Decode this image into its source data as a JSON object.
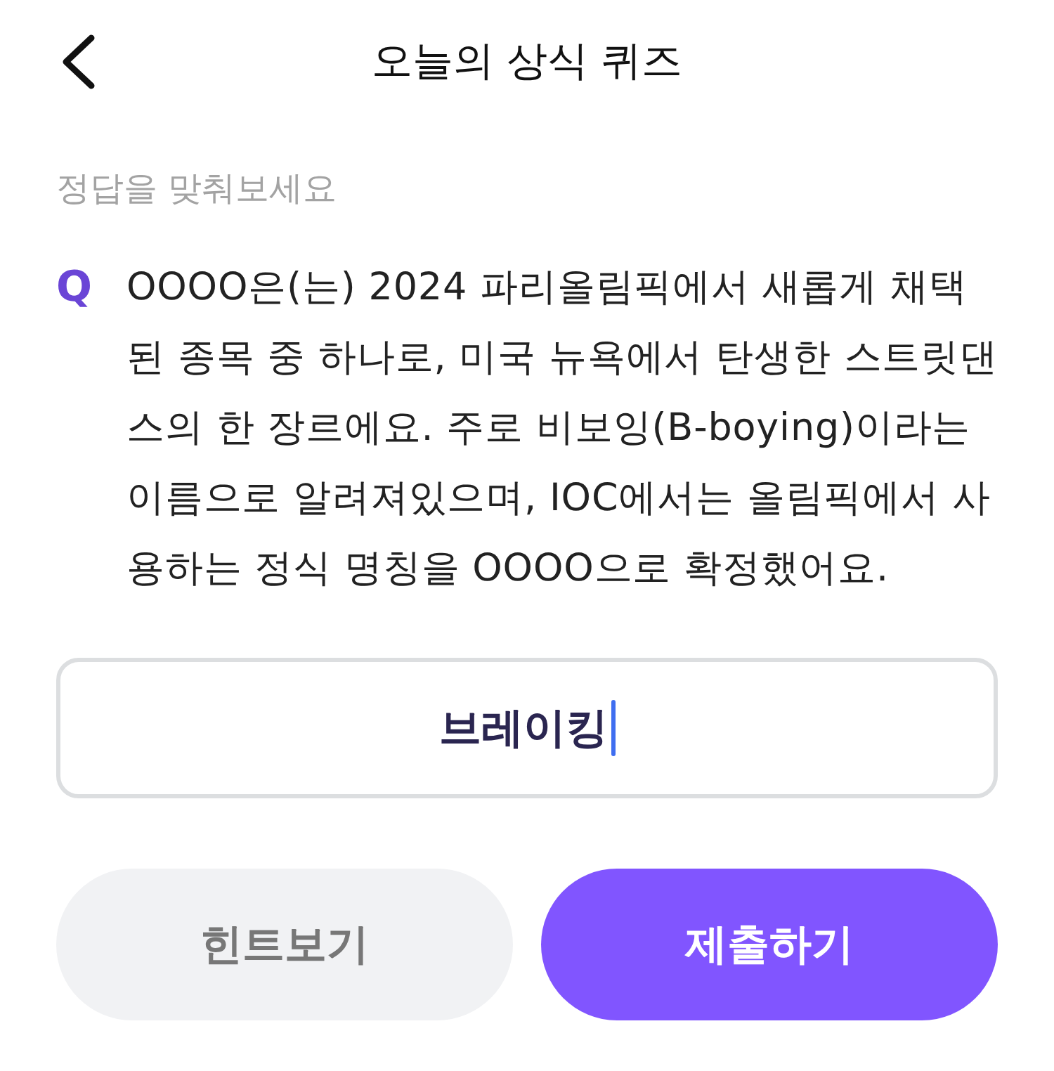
{
  "header": {
    "title": "오늘의 상식 퀴즈"
  },
  "prompt": "정답을 맞춰보세요",
  "question": {
    "marker": "Q",
    "text": "OOOO은(는) 2024 파리올림픽에서 새롭게 채택된 종목 중 하나로, 미국 뉴욕에서 탄생한 스트릿댄스의 한 장르에요. 주로 비보잉(B-boying)이라는 이름으로 알려져있으며, IOC에서는 올림픽에서 사용하는 정식 명칭을 OOOO으로 확정했어요."
  },
  "answer": {
    "value": "브레이킹",
    "focused": true
  },
  "buttons": [
    {
      "label": "힌트보기",
      "kind": "secondary"
    },
    {
      "label": "제출하기",
      "kind": "primary"
    }
  ]
}
